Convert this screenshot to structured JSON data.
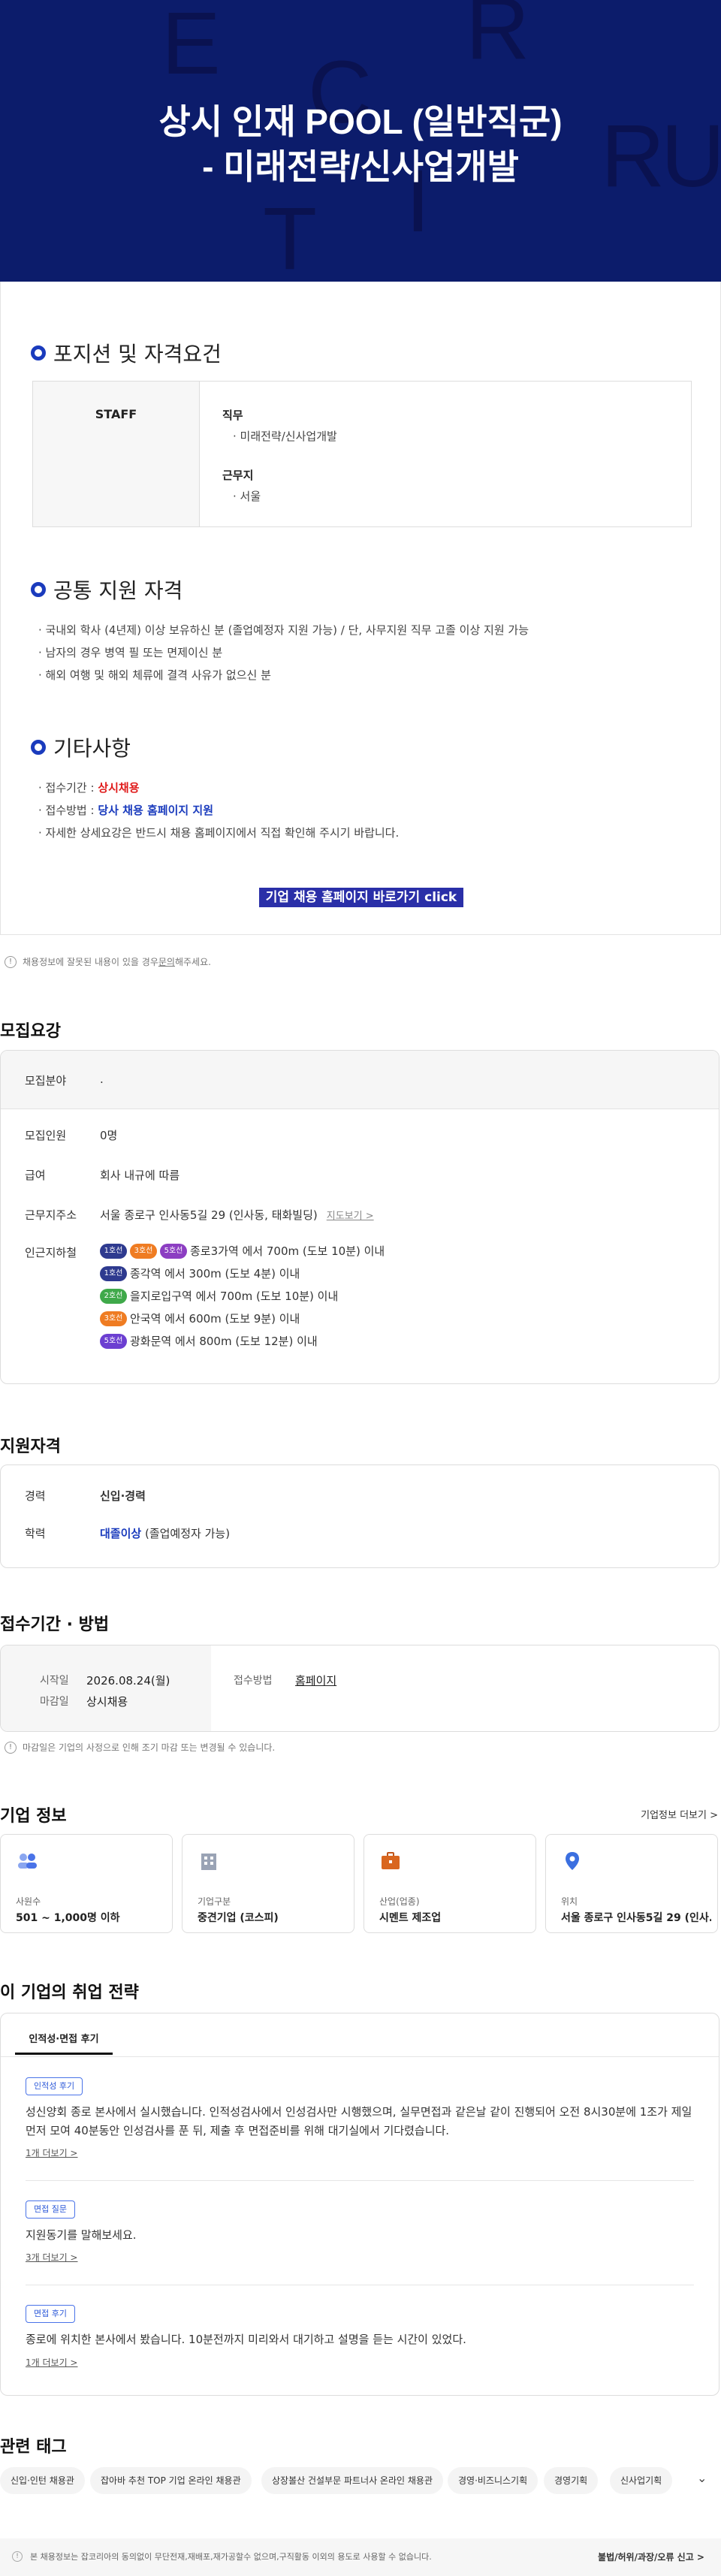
{
  "hero": {
    "title_line1": "상시 인재 POOL (일반직군)",
    "title_line2": "- 미래전략/신사업개발",
    "bg_letters": [
      "E",
      "R",
      "C",
      "R",
      "U",
      "I",
      "T"
    ]
  },
  "position": {
    "title": "포지션 및 자격요건",
    "group": "STAFF",
    "duty_label": "직무",
    "duty_value": "· 미래전략/신사업개발",
    "location_label": "근무지",
    "location_value": "· 서울"
  },
  "common": {
    "title": "공통 지원 자격",
    "items": [
      "· 국내외 학사 (4년제) 이상 보유하신 분 (졸업예정자 지원 가능) / 단, 사무지원 직무 고졸 이상 지원 가능",
      "· 남자의 경우 병역 필 또는 면제이신 분",
      "· 해외 여행 및 해외 체류에 결격 사유가 없으신 분"
    ]
  },
  "etc": {
    "title": "기타사항",
    "period_label": "· 접수기간 : ",
    "period_value": "상시채용",
    "method_label": "· 접수방법 : ",
    "method_value": "당사 채용 홈페이지 지원",
    "note": "· 자세한 상세요강은 반드시 채용 홈페이지에서 직접 확인해 주시기 바랍니다.",
    "cta": "기업 채용 홈페이지 바로가기 click"
  },
  "notice1": {
    "prefix": "채용정보에 잘못된 내용이 있을 경우 ",
    "link": "문의",
    "suffix": "해주세요."
  },
  "recruit": {
    "title": "모집요강",
    "field_label": "모집분야",
    "field_value": ".",
    "count_label": "모집인원",
    "count_value": "0명",
    "salary_label": "급여",
    "salary_value": "회사 내규에 따름",
    "address_label": "근무지주소",
    "address_value": "서울 종로구 인사동5길 29 (인사동, 태화빌딩)",
    "map_link": "지도보기 >",
    "subway_label": "인근지하철",
    "subway": [
      {
        "badges": [
          [
            "1호선",
            "navy"
          ],
          [
            "3호선",
            "orange"
          ],
          [
            "5호선",
            "purple"
          ]
        ],
        "text": "종로3가역 에서 700m (도보 10분) 이내"
      },
      {
        "badges": [
          [
            "1호선",
            "navy"
          ]
        ],
        "text": "종각역 에서 300m (도보 4분) 이내"
      },
      {
        "badges": [
          [
            "2호선",
            "green"
          ]
        ],
        "text": "을지로입구역 에서 700m (도보 10분) 이내"
      },
      {
        "badges": [
          [
            "3호선",
            "orange"
          ]
        ],
        "text": "안국역 에서 600m (도보 9분) 이내"
      },
      {
        "badges": [
          [
            "5호선",
            "violet"
          ]
        ],
        "text": "광화문역 에서 800m (도보 12분) 이내"
      }
    ]
  },
  "qual": {
    "title": "지원자격",
    "career_label": "경력",
    "career_value": "신입·경력",
    "edu_label": "학력",
    "edu_value": "대졸이상",
    "edu_suffix": " (졸업예정자 가능)"
  },
  "apply": {
    "title": "접수기간 · 방법",
    "start_label": "시작일",
    "start_value": "2026.08.24(월)",
    "end_label": "마감일",
    "end_value": "상시채용",
    "method_label": "접수방법",
    "method_value": "홈페이지",
    "notice": "마감일은 기업의 사정으로 인해 조기 마감 또는 변경될 수 있습니다."
  },
  "company": {
    "title": "기업 정보",
    "more": "기업정보 더보기 >",
    "cards": [
      {
        "label": "사원수",
        "value": "501 ~ 1,000명 이하",
        "icon": "people-icon"
      },
      {
        "label": "기업구분",
        "value": "중견기업 (코스피)",
        "icon": "building-icon"
      },
      {
        "label": "산업(업종)",
        "value": "시멘트 제조업",
        "icon": "briefcase-icon"
      },
      {
        "label": "위치",
        "value": "서울 종로구 인사동5길 29 (인사...",
        "icon": "location-pin-icon"
      }
    ]
  },
  "strategy": {
    "title": "이 기업의 취업 전략",
    "tab": "인적성·면접 후기",
    "items": [
      {
        "chip": "인적성 후기",
        "text": "성신양회 종로 본사에서 실시했습니다. 인적성검사에서 인성검사만 시행했으며, 실무면접과 같은날 같이 진행되어 오전 8시30분에 1조가 제일 먼저 모여 40분동안 인성검사를 푼 뒤, 제출 후 면접준비를 위해 대기실에서 기다렸습니다.",
        "more": "1개 더보기 >"
      },
      {
        "chip": "면접 질문",
        "text": "지원동기를 말해보세요.",
        "more": "3개 더보기 >"
      },
      {
        "chip": "면접 후기",
        "text": "종로에 위치한 본사에서 봤습니다. 10분전까지 미리와서 대기하고 설명을 듣는 시간이 있었다.",
        "more": "1개 더보기 >"
      }
    ]
  },
  "tags": {
    "title": "관련 태그",
    "items": [
      "신입·인턴 채용관",
      "잡아바 추천 TOP 기업 온라인 채용관",
      "상장볼산 건설부문 파트너사 온라인 채용관",
      "경영·비즈니스기획",
      "경영기획",
      "신사업기획"
    ]
  },
  "footer": {
    "text": "본 채용정보는 잡코리아의 동의없이 무단전재,재배포,재가공할수 없으며,구직활동 이외의 용도로 사용할 수 없습니다.",
    "report": "불법/허위/과장/오류 신고 >"
  }
}
